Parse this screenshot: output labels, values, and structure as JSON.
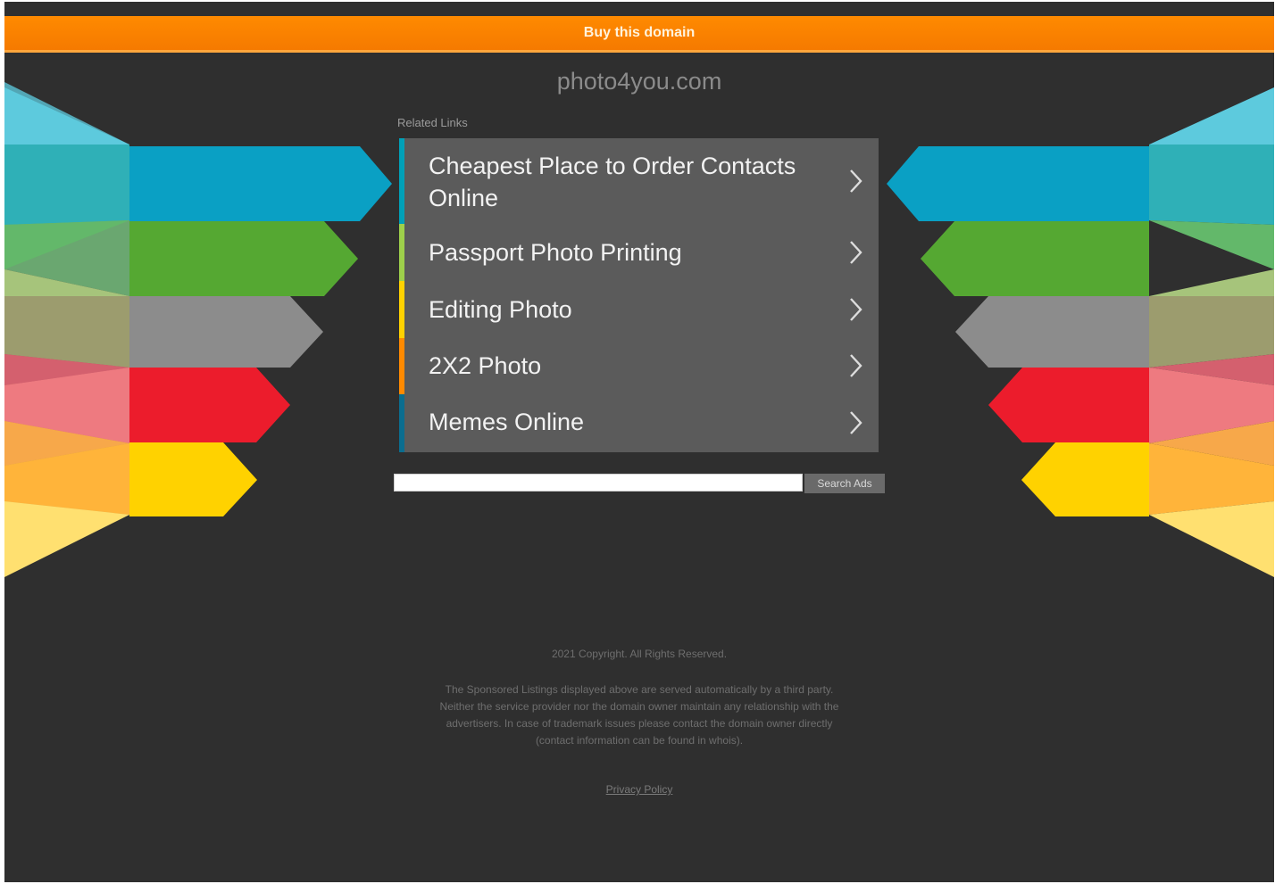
{
  "buy_bar": {
    "label": "Buy this domain"
  },
  "domain": {
    "name": "photo4you.com"
  },
  "related": {
    "heading": "Related Links",
    "links": [
      {
        "label": "Cheapest Place to Order Contacts Online",
        "accent": "#00a0b8"
      },
      {
        "label": "Passport Photo Printing",
        "accent": "#9ed04b"
      },
      {
        "label": "Editing Photo",
        "accent": "#ffd200"
      },
      {
        "label": "2X2 Photo",
        "accent": "#ff8a00"
      },
      {
        "label": "Memes Online",
        "accent": "#0b6d8f"
      }
    ]
  },
  "search": {
    "placeholder": "",
    "button_label": "Search Ads"
  },
  "footer": {
    "copyright": "2021 Copyright. All Rights Reserved.",
    "disclaimer": "The Sponsored Listings displayed above are served automatically by a third party. Neither the service provider nor the domain owner maintain any relationship with the advertisers. In case of trademark issues please contact the domain owner directly (contact information can be found in whois).",
    "privacy_label": "Privacy Policy"
  },
  "colors": {
    "background": "#2f2f2f",
    "buy_bar": "#ff8a00",
    "stripe_blue": "#0aa0c4",
    "stripe_green": "#55a832",
    "stripe_gray": "#8c8c8c",
    "stripe_red": "#ec1c2c",
    "stripe_yellow": "#ffd200"
  },
  "icons": {
    "link_arrow": "chevron-right-icon"
  }
}
